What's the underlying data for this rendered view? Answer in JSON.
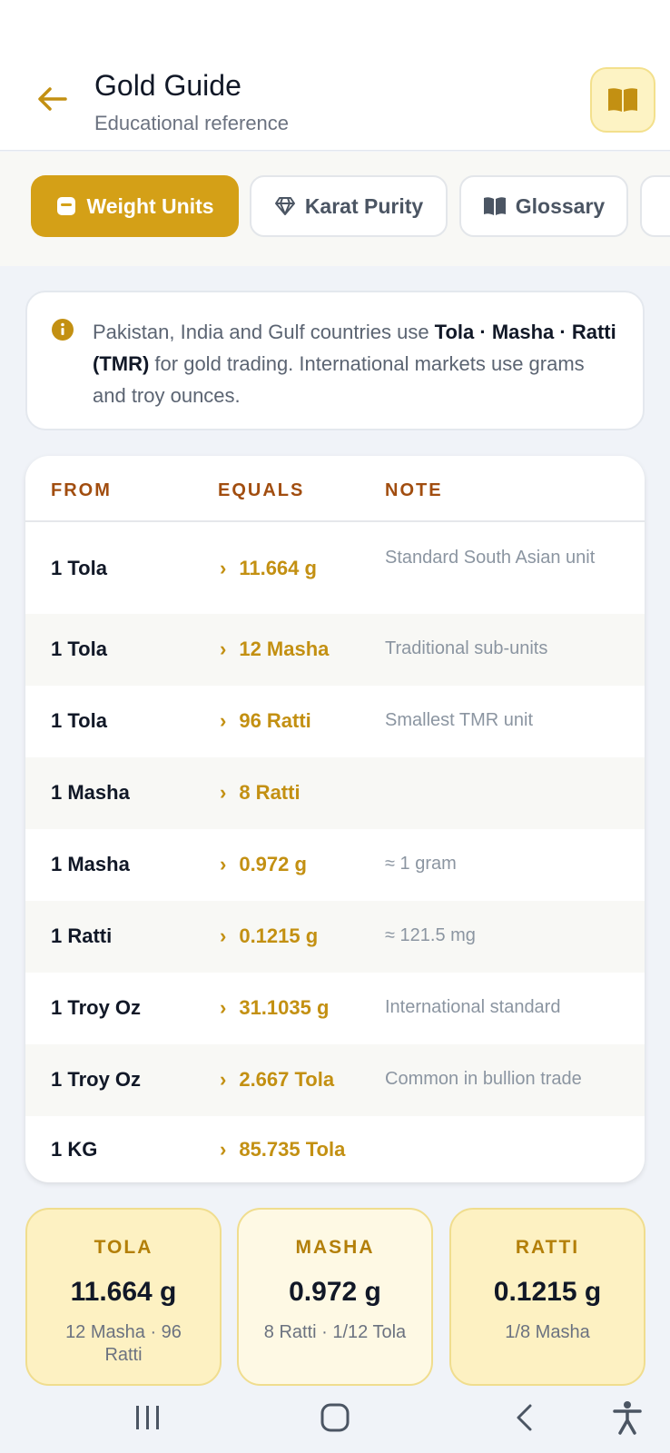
{
  "header": {
    "title": "Gold Guide",
    "subtitle": "Educational reference"
  },
  "tabs": [
    {
      "label": "Weight Units",
      "icon": "weight-icon",
      "active": true
    },
    {
      "label": "Karat Purity",
      "icon": "diamond-icon",
      "active": false
    },
    {
      "label": "Glossary",
      "icon": "book-icon",
      "active": false
    }
  ],
  "info": {
    "text_part1": "Pakistan, India and Gulf countries use ",
    "text_bold": "Tola · Masha · Ratti (TMR)",
    "text_part2": " for gold trading. International markets use grams and troy ounces."
  },
  "table": {
    "headers": {
      "from": "FROM",
      "equals": "EQUALS",
      "note": "NOTE"
    },
    "rows": [
      {
        "from": "1 Tola",
        "equals": "11.664 g",
        "note": "Standard South Asian unit"
      },
      {
        "from": "1 Tola",
        "equals": "12 Masha",
        "note": "Traditional sub-units"
      },
      {
        "from": "1 Tola",
        "equals": "96 Ratti",
        "note": "Smallest TMR unit"
      },
      {
        "from": "1 Masha",
        "equals": "8 Ratti",
        "note": ""
      },
      {
        "from": "1 Masha",
        "equals": "0.972 g",
        "note": "≈ 1 gram"
      },
      {
        "from": "1 Ratti",
        "equals": "0.1215 g",
        "note": "≈ 121.5 mg"
      },
      {
        "from": "1 Troy Oz",
        "equals": "31.1035 g",
        "note": "International standard"
      },
      {
        "from": "1 Troy Oz",
        "equals": "2.667 Tola",
        "note": "Common in bullion trade"
      },
      {
        "from": "1 KG",
        "equals": "85.735 Tola",
        "note": ""
      }
    ]
  },
  "unit_cards": [
    {
      "label": "TOLA",
      "value": "11.664 g",
      "sub": "12 Masha · 96 Ratti"
    },
    {
      "label": "MASHA",
      "value": "0.972 g",
      "sub": "8 Ratti · 1/12 Tola"
    },
    {
      "label": "RATTI",
      "value": "0.1215 g",
      "sub": "1/8 Masha"
    }
  ],
  "colors": {
    "accent": "#d4a017",
    "accent_text": "#c39012",
    "header_brown": "#a14d0f"
  }
}
